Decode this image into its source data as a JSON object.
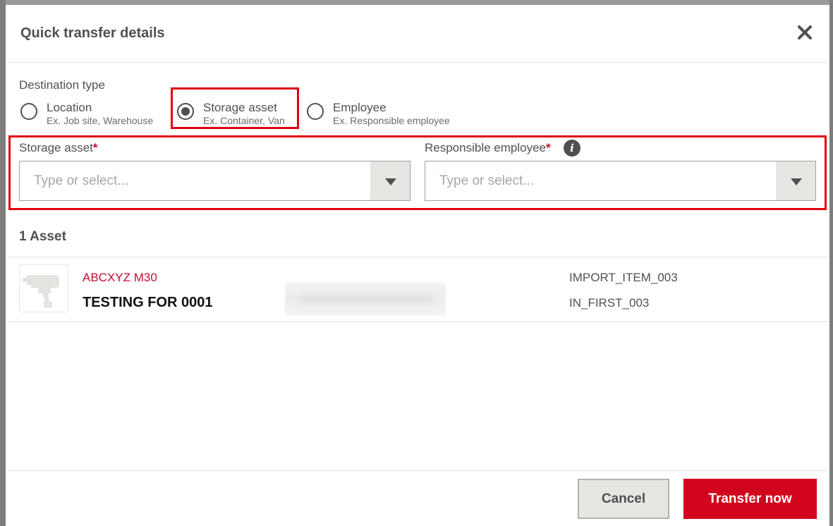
{
  "modal": {
    "title": "Quick transfer details"
  },
  "destination": {
    "label": "Destination type",
    "options": [
      {
        "label": "Location",
        "hint": "Ex. Job site, Warehouse",
        "selected": false
      },
      {
        "label": "Storage asset",
        "hint": "Ex. Container, Van",
        "selected": true
      },
      {
        "label": "Employee",
        "hint": "Ex. Responsible employee",
        "selected": false
      }
    ]
  },
  "fields": {
    "storage_asset": {
      "label": "Storage asset",
      "required_mark": "*",
      "value": "",
      "placeholder": "Type or select..."
    },
    "responsible_employee": {
      "label": "Responsible employee",
      "required_mark": "*",
      "value": "",
      "placeholder": "Type or select..."
    }
  },
  "asset_list": {
    "count_label": "1 Asset",
    "items": [
      {
        "code": "ABCXYZ M30",
        "name": "TESTING FOR 0001",
        "meta1": "IMPORT_ITEM_003",
        "meta2": "IN_FIRST_003"
      }
    ]
  },
  "footer": {
    "cancel_label": "Cancel",
    "transfer_label": "Transfer now"
  },
  "colors": {
    "accent_red": "#d2051e",
    "highlight_red": "#e3000f",
    "text_dark": "#524f53",
    "link_red": "#c40f2b",
    "toggle_bg": "#e7e6e2"
  },
  "icons": {
    "close": "close-icon",
    "info": "info-icon",
    "dropdown": "chevron-down-icon",
    "thumbnail": "power-drill-icon"
  }
}
